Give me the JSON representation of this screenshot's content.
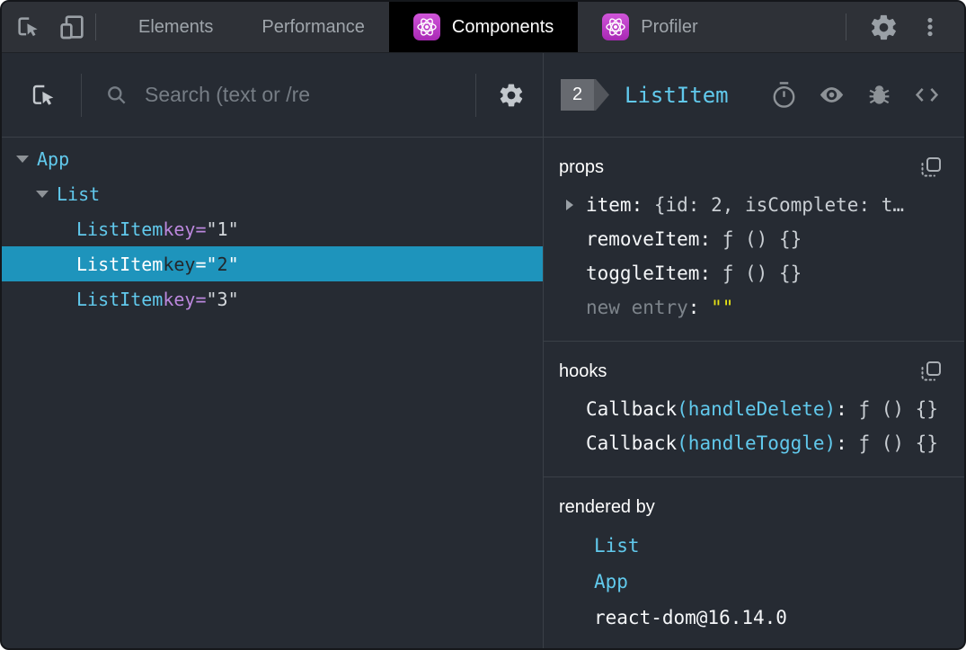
{
  "tabbar": {
    "tabs": [
      {
        "label": "Elements",
        "icon": false,
        "active": false
      },
      {
        "label": "Performance",
        "icon": false,
        "active": false
      },
      {
        "label": "Components",
        "icon": true,
        "active": true
      },
      {
        "label": "Profiler",
        "icon": true,
        "active": false
      }
    ]
  },
  "left_panel": {
    "search_placeholder": "Search (text or /re",
    "tree": [
      {
        "depth": 0,
        "caret": true,
        "name": "App",
        "selected": false
      },
      {
        "depth": 1,
        "caret": true,
        "name": "List",
        "selected": false
      },
      {
        "depth": 2,
        "caret": false,
        "name": "ListItem",
        "attr": "key",
        "eq": "=",
        "value": "\"1\"",
        "selected": false
      },
      {
        "depth": 2,
        "caret": false,
        "name": "ListItem",
        "attr": "key",
        "eq": "=",
        "value": "\"2\"",
        "selected": true
      },
      {
        "depth": 2,
        "caret": false,
        "name": "ListItem",
        "attr": "key",
        "eq": "=",
        "value": "\"3\"",
        "selected": false
      }
    ]
  },
  "right_panel": {
    "badge_count": "2",
    "component_name": "ListItem",
    "sections": [
      {
        "id": "props",
        "title": "props",
        "copy_icon": true,
        "rows": [
          {
            "expandable": true,
            "segments": [
              {
                "t": "item",
                "c": "key"
              },
              {
                "t": ": ",
                "c": "white"
              },
              {
                "t": "{id: 2, isComplete: t…",
                "c": "value"
              }
            ]
          },
          {
            "expandable": false,
            "segments": [
              {
                "t": "removeItem",
                "c": "key"
              },
              {
                "t": ": ",
                "c": "white"
              },
              {
                "t": "ƒ () {}",
                "c": "value"
              }
            ]
          },
          {
            "expandable": false,
            "segments": [
              {
                "t": "toggleItem",
                "c": "key"
              },
              {
                "t": ": ",
                "c": "white"
              },
              {
                "t": "ƒ () {}",
                "c": "value"
              }
            ]
          },
          {
            "expandable": false,
            "segments": [
              {
                "t": "new entry",
                "c": "muted"
              },
              {
                "t": ": ",
                "c": "white"
              },
              {
                "t": "\"\"",
                "c": "string"
              }
            ]
          }
        ]
      },
      {
        "id": "hooks",
        "title": "hooks",
        "copy_icon": true,
        "rows": [
          {
            "expandable": false,
            "segments": [
              {
                "t": "Callback",
                "c": "key"
              },
              {
                "t": "(handleDelete)",
                "c": "cyan"
              },
              {
                "t": ": ",
                "c": "white"
              },
              {
                "t": "ƒ () {}",
                "c": "value"
              }
            ]
          },
          {
            "expandable": false,
            "segments": [
              {
                "t": "Callback",
                "c": "key"
              },
              {
                "t": "(handleToggle)",
                "c": "cyan"
              },
              {
                "t": ": ",
                "c": "white"
              },
              {
                "t": "ƒ () {}",
                "c": "value"
              }
            ]
          }
        ]
      },
      {
        "id": "rendered-by",
        "title": "rendered by",
        "copy_icon": false,
        "rows": [
          {
            "expandable": false,
            "segments": [
              {
                "t": "List",
                "c": "cyan"
              }
            ]
          },
          {
            "expandable": false,
            "segments": [
              {
                "t": "App",
                "c": "cyan"
              }
            ]
          },
          {
            "expandable": false,
            "segments": [
              {
                "t": "react-dom@16.14.0",
                "c": "white"
              }
            ]
          }
        ]
      }
    ]
  },
  "colors": {
    "component_cyan": "#61c9ec",
    "attr_purple": "#bb87dd",
    "string_yellow": "#e8e414",
    "selected_row_bg": "#1e94bc",
    "react_icon_purple": "#c13ecb",
    "active_tab_bg": "#000000"
  }
}
